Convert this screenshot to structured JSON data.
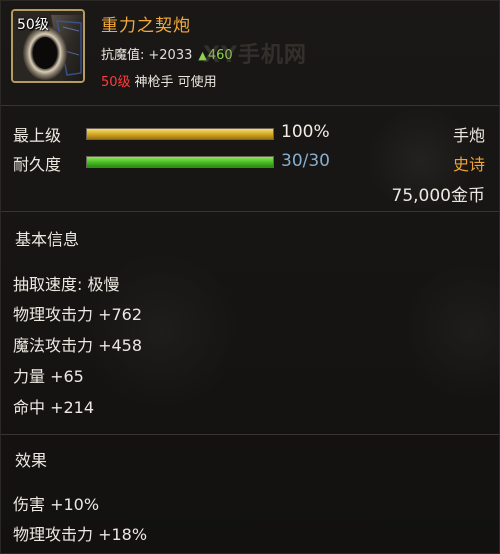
{
  "item": {
    "level_badge": "50级",
    "name": "重力之契炮",
    "icon": "cannon-icon",
    "resist_label": "抗魔值:",
    "resist_value": "+2033",
    "resist_bonus": "460",
    "required_level": "50级",
    "required_class": "神枪手 可使用",
    "watermark": "XY手机网"
  },
  "bars": {
    "upgrade_label": "最上级",
    "upgrade_value": "100%",
    "upgrade_fraction": 1.0,
    "durability_label": "耐久度",
    "durability_value": "30/30",
    "durability_fraction": 1.0
  },
  "info_right": {
    "weapon_type": "手炮",
    "rarity": "史诗",
    "price": "75,000金币"
  },
  "basic_info": {
    "title": "基本信息",
    "lines": [
      "抽取速度: 极慢",
      "物理攻击力 +762",
      "魔法攻击力 +458",
      "力量 +65",
      "命中 +214"
    ]
  },
  "effects": {
    "title": "效果",
    "lines": [
      "伤害 +10%",
      "物理攻击力 +18%"
    ]
  },
  "colors": {
    "item_name": "#f3aa3c",
    "rarity_epic": "#f0a138",
    "required_level": "#ff3b3b",
    "bonus_green": "#8fd14f",
    "durability_text": "#87aecd",
    "frame_gold": "#b79c60"
  }
}
